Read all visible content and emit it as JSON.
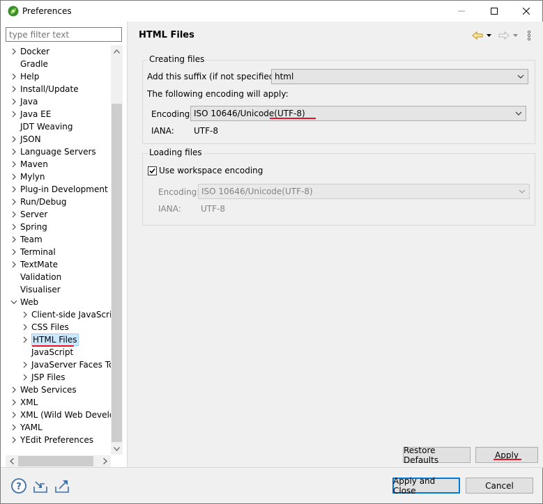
{
  "window": {
    "title": "Preferences"
  },
  "filter": {
    "placeholder": "type filter text"
  },
  "tree": {
    "items": [
      {
        "label": "Docker",
        "expandable": true,
        "level": 0
      },
      {
        "label": "Gradle",
        "expandable": false,
        "level": 0
      },
      {
        "label": "Help",
        "expandable": true,
        "level": 0
      },
      {
        "label": "Install/Update",
        "expandable": true,
        "level": 0
      },
      {
        "label": "Java",
        "expandable": true,
        "level": 0
      },
      {
        "label": "Java EE",
        "expandable": true,
        "level": 0
      },
      {
        "label": "JDT Weaving",
        "expandable": false,
        "level": 0
      },
      {
        "label": "JSON",
        "expandable": true,
        "level": 0
      },
      {
        "label": "Language Servers",
        "expandable": true,
        "level": 0
      },
      {
        "label": "Maven",
        "expandable": true,
        "level": 0
      },
      {
        "label": "Mylyn",
        "expandable": true,
        "level": 0
      },
      {
        "label": "Plug-in Development",
        "expandable": true,
        "level": 0
      },
      {
        "label": "Run/Debug",
        "expandable": true,
        "level": 0
      },
      {
        "label": "Server",
        "expandable": true,
        "level": 0
      },
      {
        "label": "Spring",
        "expandable": true,
        "level": 0
      },
      {
        "label": "Team",
        "expandable": true,
        "level": 0
      },
      {
        "label": "Terminal",
        "expandable": true,
        "level": 0
      },
      {
        "label": "TextMate",
        "expandable": true,
        "level": 0
      },
      {
        "label": "Validation",
        "expandable": false,
        "level": 0
      },
      {
        "label": "Visualiser",
        "expandable": false,
        "level": 0
      },
      {
        "label": "Web",
        "expandable": true,
        "expanded": true,
        "level": 0
      },
      {
        "label": "Client-side JavaScript",
        "expandable": true,
        "level": 1
      },
      {
        "label": "CSS Files",
        "expandable": true,
        "level": 1
      },
      {
        "label": "HTML Files",
        "expandable": true,
        "level": 1,
        "selected": true
      },
      {
        "label": "JavaScript",
        "expandable": false,
        "level": 1
      },
      {
        "label": "JavaServer Faces Tools",
        "expandable": true,
        "level": 1
      },
      {
        "label": "JSP Files",
        "expandable": true,
        "level": 1
      },
      {
        "label": "Web Services",
        "expandable": true,
        "level": 0
      },
      {
        "label": "XML",
        "expandable": true,
        "level": 0
      },
      {
        "label": "XML (Wild Web Developer)",
        "expandable": true,
        "level": 0
      },
      {
        "label": "YAML",
        "expandable": true,
        "level": 0
      },
      {
        "label": "YEdit Preferences",
        "expandable": true,
        "level": 0
      }
    ]
  },
  "page": {
    "title": "HTML Files",
    "creating": {
      "title": "Creating files",
      "suffix_label": "Add this suffix (if not specified):",
      "suffix_value": "html",
      "encoding_note": "The following encoding will apply:",
      "encoding_label": "Encoding:",
      "encoding_value_prefix": "ISO 10646/Unicode",
      "encoding_value_suffix": "(UTF-8)",
      "iana_label": "IANA:",
      "iana_value": "UTF-8"
    },
    "loading": {
      "title": "Loading files",
      "use_workspace_label": "Use workspace encoding",
      "use_workspace_checked": true,
      "encoding_label": "Encoding:",
      "encoding_value": "ISO 10646/Unicode(UTF-8)",
      "iana_label": "IANA:",
      "iana_value": "UTF-8"
    }
  },
  "buttons": {
    "restore_defaults": "Restore Defaults",
    "apply": "Apply",
    "apply_and_close": "Apply and Close",
    "cancel": "Cancel"
  },
  "colors": {
    "accent": "#0078d7",
    "annotation_red": "#e81123",
    "selection": "#cce8ff"
  }
}
